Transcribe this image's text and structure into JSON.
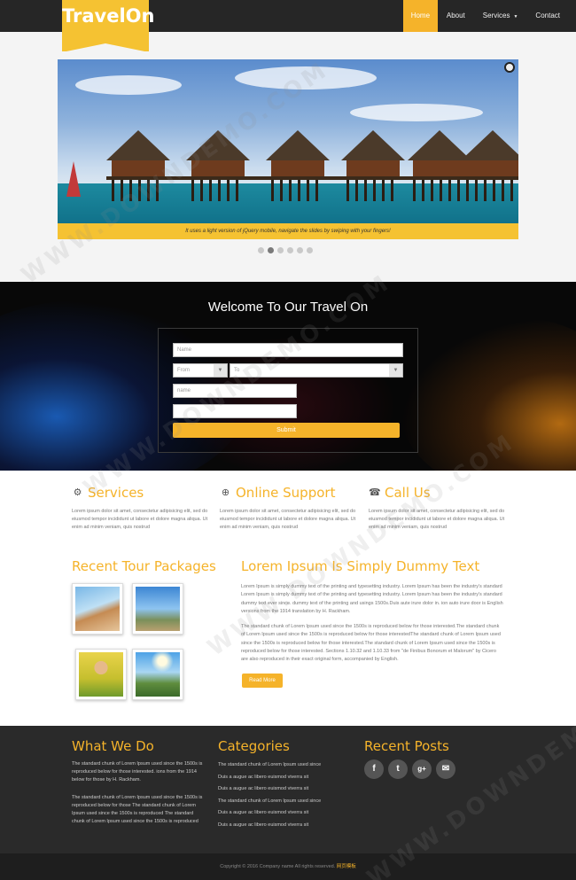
{
  "brand": {
    "name": "TravelOn"
  },
  "nav": {
    "items": [
      {
        "label": "Home",
        "active": true
      },
      {
        "label": "About",
        "active": false
      },
      {
        "label": "Services",
        "active": false,
        "has_dropdown": true
      },
      {
        "label": "Contact",
        "active": false
      }
    ]
  },
  "slider": {
    "caption": "It uses a light version of jQuery mobile, navigate the slides by swiping with your fingers!",
    "dot_count": 6,
    "active_dot": 1
  },
  "booking": {
    "title": "Welcome To Our Travel On",
    "name_placeholder": "Name",
    "from_placeholder": "From",
    "to_placeholder": "To",
    "field3_placeholder": "name",
    "field4_placeholder": "",
    "submit_label": "Submit"
  },
  "features": [
    {
      "title": "Services",
      "icon": "gear-icon",
      "text": "Lorem ipsum dolor sit amet, consectetur adipisicing elit, sed do eiusmod tempor incididunt ut labore et dolore magna aliqua. Ut enim ad minim veniam, quis nostrud"
    },
    {
      "title": "Online Support",
      "icon": "lifebuoy-icon",
      "text": "Lorem ipsum dolor sit amet, consectetur adipisicing elit, sed do eiusmod tempor incididunt ut labore et dolore magna aliqua. Ut enim ad minim veniam, quis nostrud"
    },
    {
      "title": "Call Us",
      "icon": "phone-icon",
      "text": "Lorem ipsum dolor sit amet, consectetur adipisicing elit, sed do eiusmod tempor incididunt ut labore et dolore magna aliqua. Ut enim ad minim veniam, quis nostrud"
    }
  ],
  "tours": {
    "title": "Recent Tour Packages"
  },
  "article": {
    "title": "Lorem Ipsum Is Simply Dummy Text",
    "para1": "Lorem Ipsum is simply dummy text of the printing and typesetting industry. Lorem Ipsum has been the industry's standard Lorem Ipsum is simply dummy text of the printing and typesetting industry. Lorem Ipsum has been the industry's standard dummy text ever since. dummy text of the printing and usings 1500s.Duis aute irure dolor in. ion auto irure door is English versions from the 1914 translation by H. Rackham.",
    "para2": "The standard chunk of Lorem Ipsum used since the 1500s is reproduced below for those interested.The standard chunk of Lorem Ipsum used since the 1500s is reproduced below for those interestedThe standard chunk of Lorem Ipsum used since the 1500s is reproduced below for those interested.The standard chunk of Lorem Ipsum used since the 1500s is reproduced below for those interested. Sections 1.10.32 and 1.10.33 from \"de Finibus Bonorum et Malorum\" by Cicero are also reproduced in their exact original form, accompanied by English.",
    "read_more_label": "Read More"
  },
  "footer": {
    "what_we_do": {
      "title": "What We Do",
      "para1": "The standard chunk of Lorem Ipsum used since the 1500s is reproduced below for those interested. ions from the 1914 below for those by H. Rackham.",
      "para2": "The standard chunk of Lorem Ipsum used since the 1500s is reproduced below for those The standard chunk of Lorem Ipsum used since the 1500s is reproduced The standard chunk of Lorem Ipsum used since the 1500s is reproduced"
    },
    "categories": {
      "title": "Categories",
      "links": [
        "The standard chunk of Lorem Ipsum used since",
        "Duis a augue ac libero euismod viverra sit",
        "Duis a augue ac libero euismod viverra sit",
        "The standard chunk of Lorem Ipsum used since",
        "Duis a augue ac libero euismod viverra sit",
        "Duis a augue ac libero euismod viverra sit"
      ]
    },
    "recent_posts": {
      "title": "Recent Posts",
      "social": [
        {
          "icon": "facebook-icon",
          "glyph": "f"
        },
        {
          "icon": "twitter-icon",
          "glyph": "t"
        },
        {
          "icon": "googleplus-icon",
          "glyph": "g+"
        },
        {
          "icon": "mail-icon",
          "glyph": "✉"
        }
      ]
    },
    "copyright": "Copyright © 2016 Company name All rights reserved.",
    "copyright_link": "网页模板"
  },
  "watermark": "WWW.DOWNDEMO.COM",
  "colors": {
    "accent": "#f5b32a",
    "dark": "#262626",
    "footer": "#2a2a2a"
  }
}
